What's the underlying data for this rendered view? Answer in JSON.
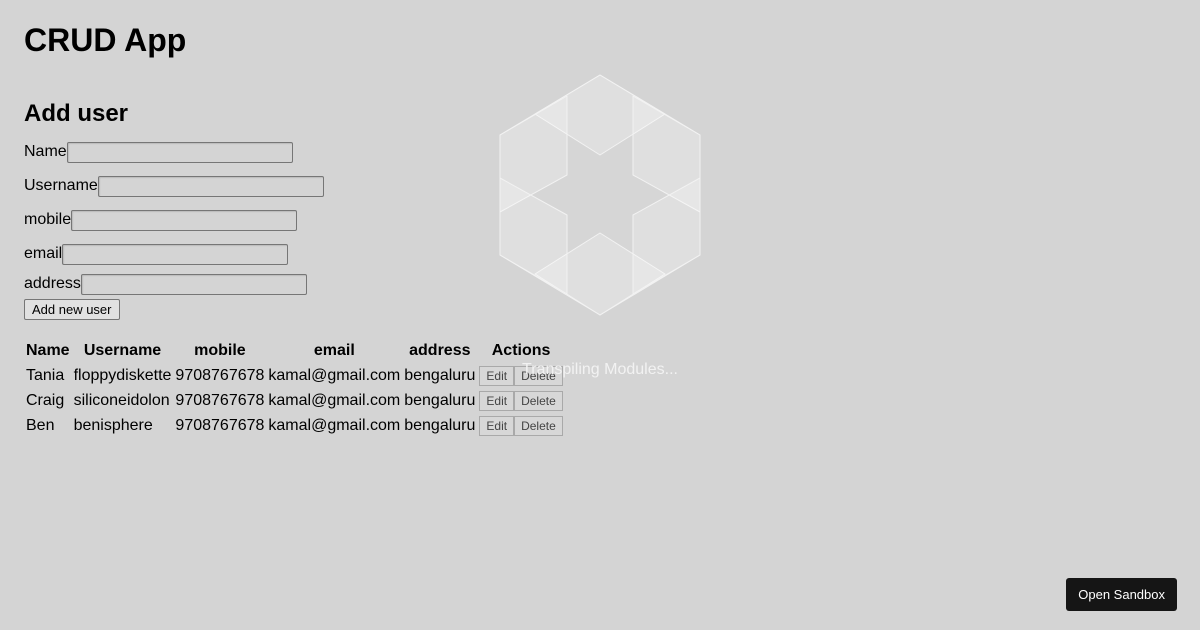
{
  "app": {
    "title": "CRUD App"
  },
  "add_form": {
    "title": "Add user",
    "fields": {
      "name": {
        "label": "Name",
        "value": ""
      },
      "username": {
        "label": "Username",
        "value": ""
      },
      "mobile": {
        "label": "mobile",
        "value": ""
      },
      "email": {
        "label": "email",
        "value": ""
      },
      "address": {
        "label": "address",
        "value": ""
      }
    },
    "submit_label": "Add new user"
  },
  "table": {
    "headers": [
      "Name",
      "Username",
      "mobile",
      "email",
      "address",
      "Actions"
    ],
    "rows": [
      {
        "name": "Tania",
        "username": "floppydiskette",
        "mobile": "9708767678",
        "email": "kamal@gmail.com",
        "address": "bengaluru",
        "edit": "Edit",
        "delete": "Delete"
      },
      {
        "name": "Craig",
        "username": "siliconeidolon",
        "mobile": "9708767678",
        "email": "kamal@gmail.com",
        "address": "bengaluru",
        "edit": "Edit",
        "delete": "Delete"
      },
      {
        "name": "Ben",
        "username": "benisphere",
        "mobile": "9708767678",
        "email": "kamal@gmail.com",
        "address": "bengaluru",
        "edit": "Edit",
        "delete": "Delete"
      }
    ]
  },
  "overlay": {
    "loading_text": "Transpiling Modules...",
    "icon": "codesandbox-hexagon-icon"
  },
  "sandbox_button": {
    "label": "Open Sandbox"
  },
  "colors": {
    "background": "#d4d4d4",
    "sandbox_button_bg": "#151515",
    "loader_stroke": "#f2f2f2"
  }
}
